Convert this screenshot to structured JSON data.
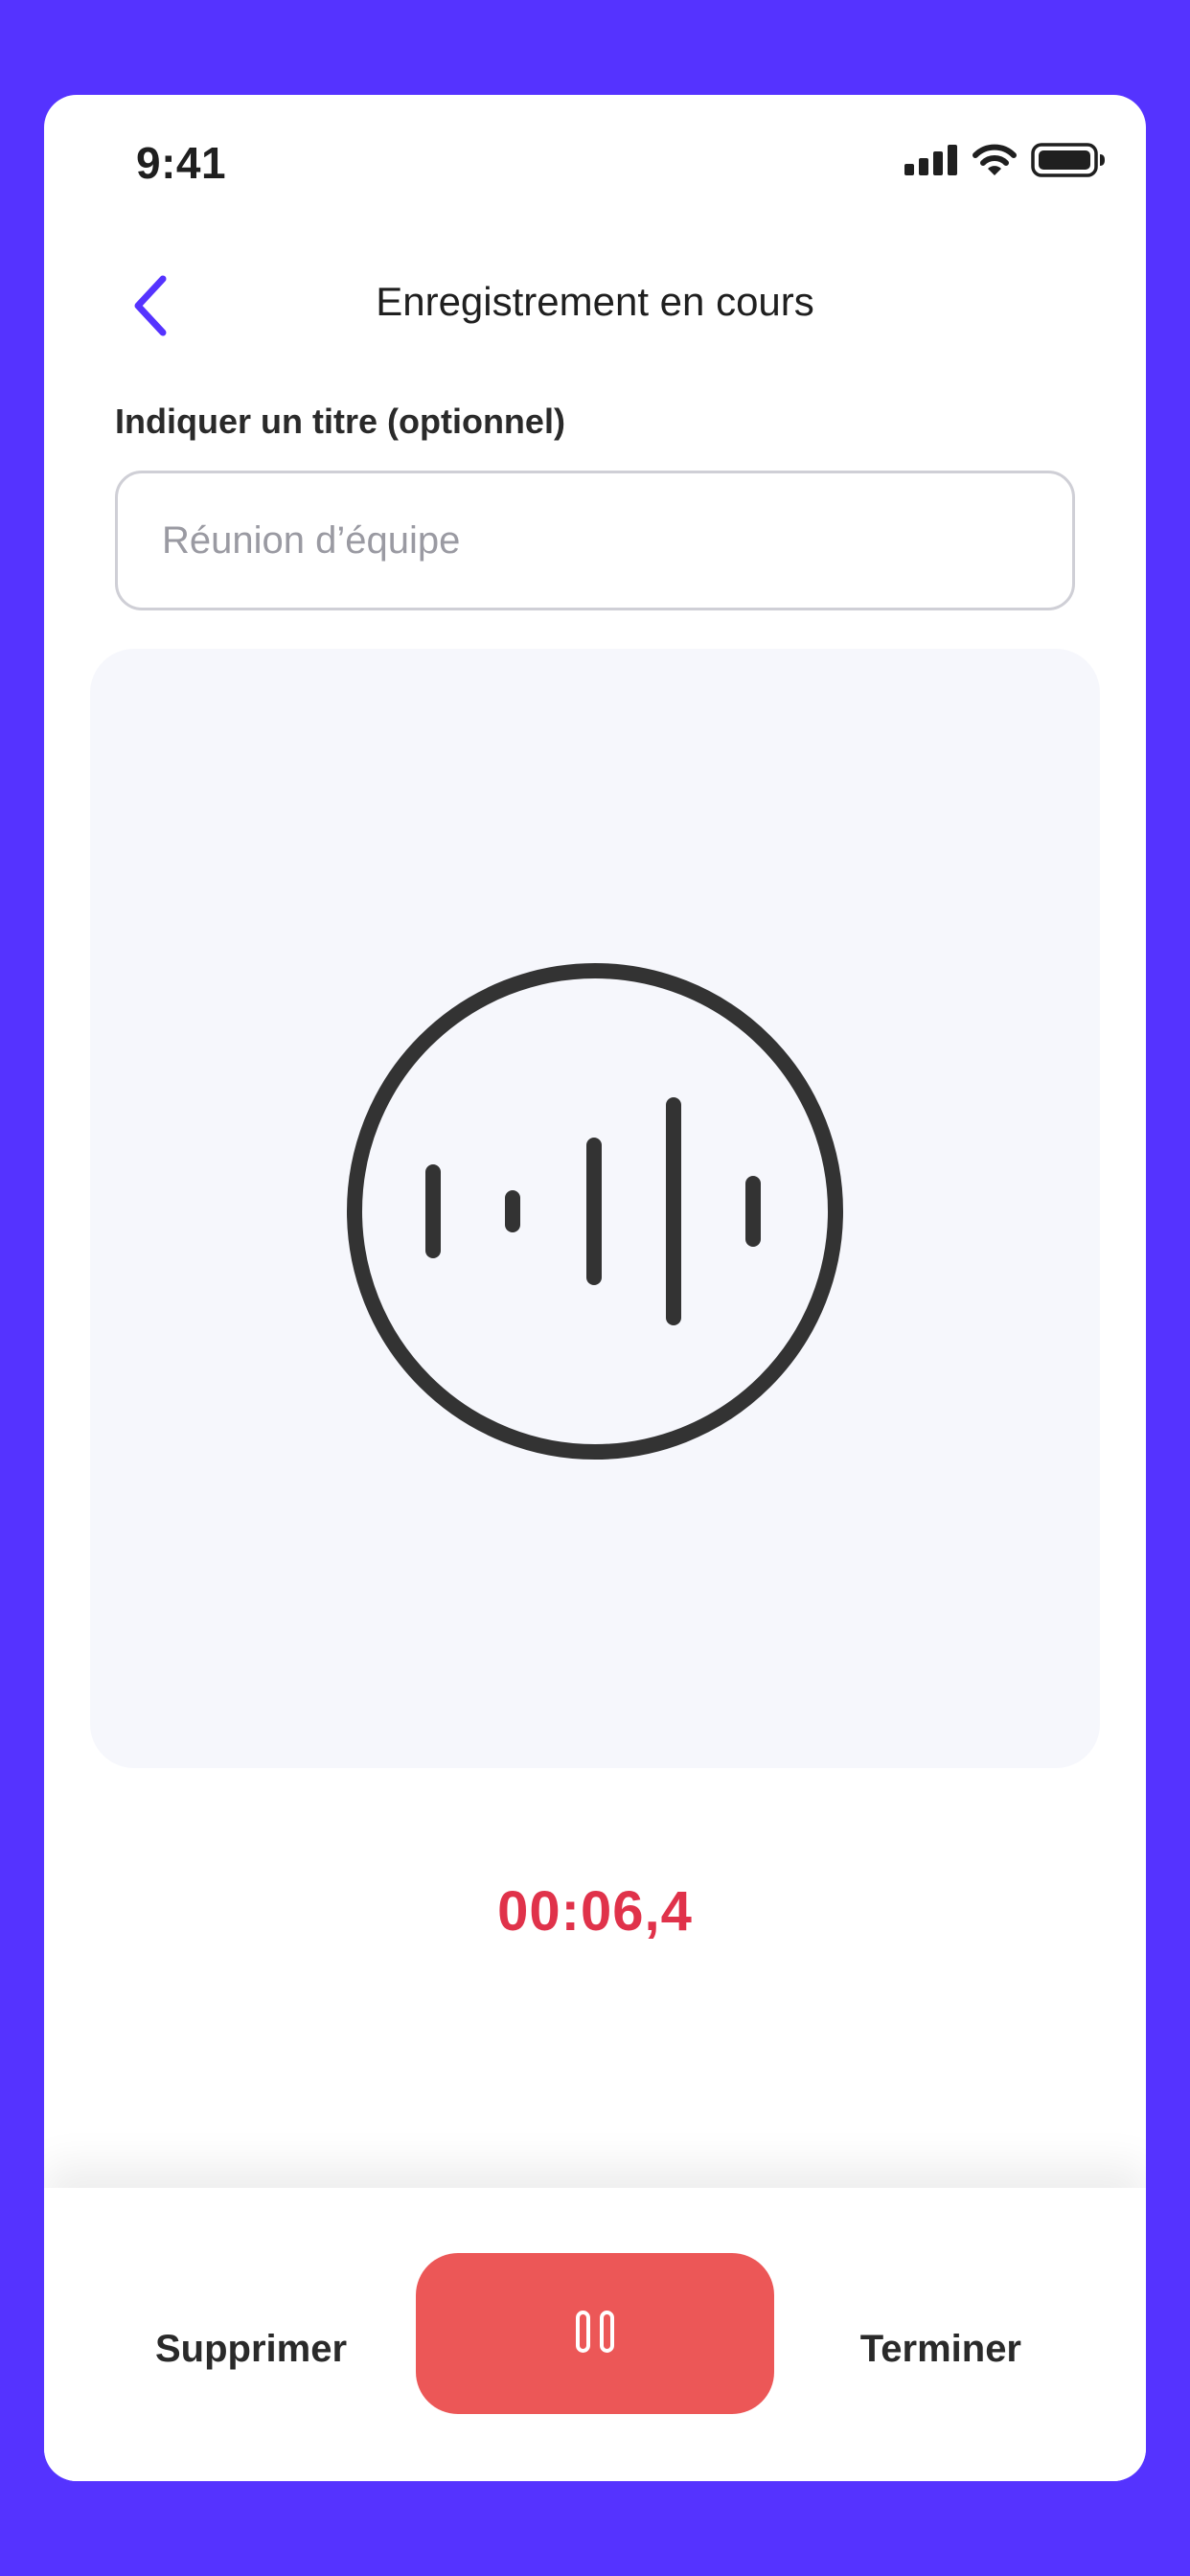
{
  "status_bar": {
    "time": "9:41",
    "icons": [
      "signal-icon",
      "wifi-icon",
      "battery-icon"
    ]
  },
  "header": {
    "back_icon": "chevron-left-icon",
    "title": "Enregistrement en cours"
  },
  "title_field": {
    "label": "Indiquer un titre (optionnel)",
    "placeholder": "Réunion d’équipe",
    "value": ""
  },
  "visual": {
    "icon": "audio-waveform-circle-icon"
  },
  "timer": {
    "elapsed": "00:06,4"
  },
  "actions": {
    "delete_label": "Supprimer",
    "pause_icon": "pause-icon",
    "finish_label": "Terminer"
  },
  "colors": {
    "background": "#5533FF",
    "accent": "#5533FF",
    "timer": "#E0324A",
    "pause_button": "#EC5757",
    "panel": "#F6F7FC"
  }
}
